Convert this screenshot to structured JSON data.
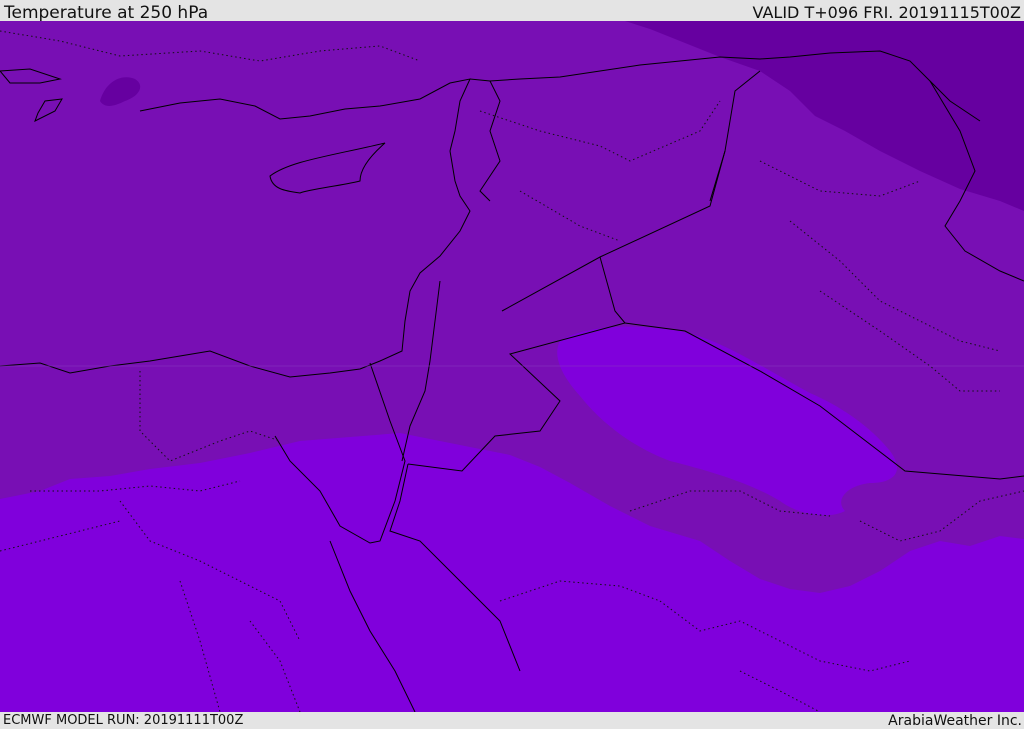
{
  "header": {
    "title": "Temperature at 250 hPa",
    "valid": "VALID T+096 FRI. 20191115T00Z"
  },
  "footer": {
    "model_run": "ECMWF MODEL RUN: 20191111T00Z",
    "credit": "ArabiaWeather Inc."
  },
  "map": {
    "colors": {
      "band_warm": "#8000dc",
      "band_mid": "#780fb4",
      "band_cold": "#6600a0",
      "border": "#000000"
    }
  }
}
